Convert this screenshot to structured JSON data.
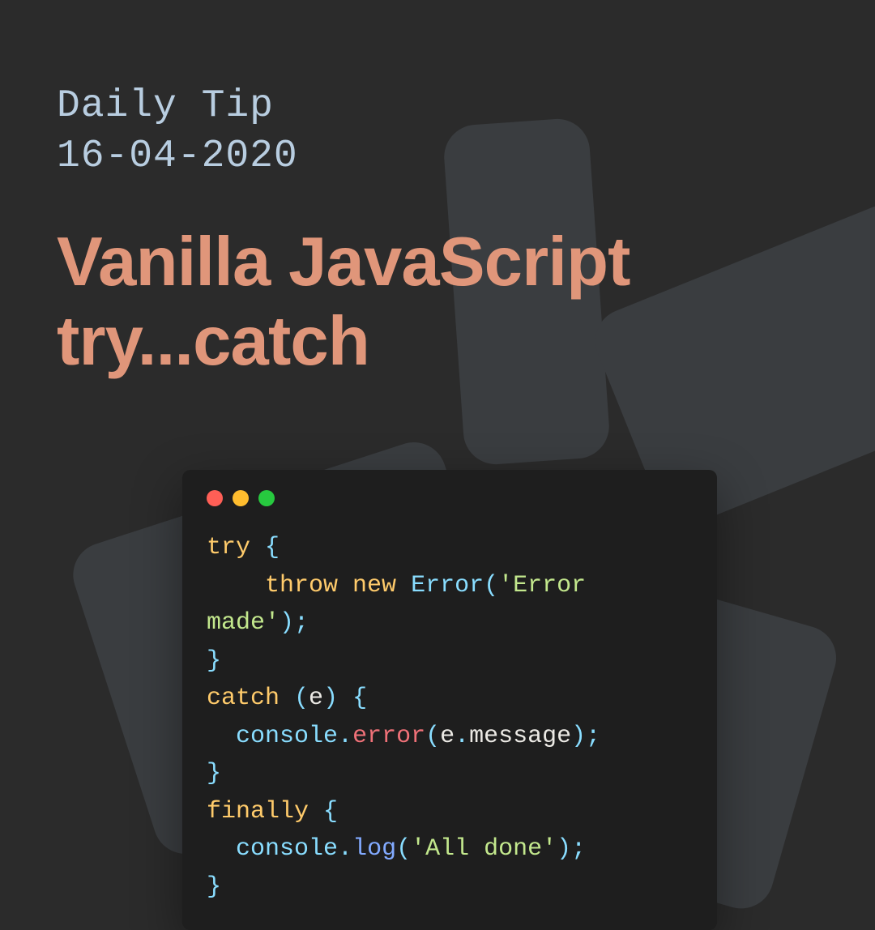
{
  "header": {
    "subtitle_line1": "Daily Tip",
    "subtitle_line2": "16-04-2020",
    "title_line1": "Vanilla JavaScript",
    "title_line2": "try...catch"
  },
  "code": {
    "t1": "try ",
    "brace_open1": "{",
    "indent1": "    ",
    "throw": "throw ",
    "new": "new ",
    "error_cls": "Error",
    "paren_open1": "(",
    "q1": "'",
    "str_error": "Error ",
    "str_made": "made",
    "q2": "'",
    "paren_close1": ")",
    "semi1": ";",
    "brace_close1": "}",
    "catch": "catch ",
    "paren_open2": "(",
    "e_param": "e",
    "paren_close2": ") ",
    "brace_open2": "{",
    "indent2": "  ",
    "console1": "console",
    "dot1": ".",
    "error_fn": "error",
    "paren_open3": "(",
    "e_msg": "e",
    "dot2": ".",
    "message": "message",
    "paren_close3": ")",
    "semi2": ";",
    "brace_close2": "}",
    "finally": "finally ",
    "brace_open3": "{",
    "indent3": "  ",
    "console2": "console",
    "dot3": ".",
    "log_fn": "log",
    "paren_open4": "(",
    "q3": "'",
    "str_done": "All done",
    "q4": "'",
    "paren_close4": ")",
    "semi3": ";",
    "brace_close3": "}"
  }
}
